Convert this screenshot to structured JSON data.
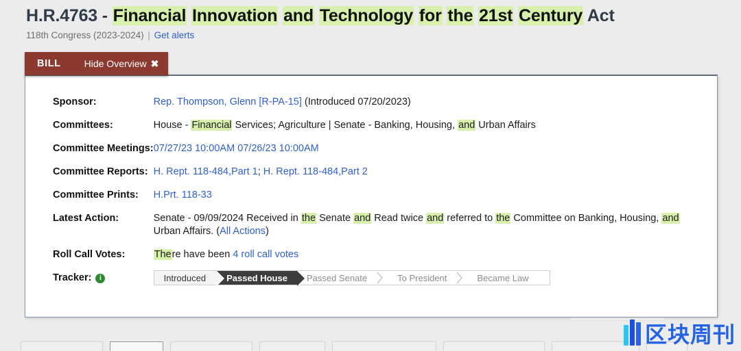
{
  "header": {
    "bill_number": "H.R.4763 - ",
    "title_tokens": [
      {
        "t": "Financial",
        "hl": true
      },
      {
        "t": " ",
        "hl": false
      },
      {
        "t": "Innovation",
        "hl": true
      },
      {
        "t": " ",
        "hl": false
      },
      {
        "t": "and",
        "hl": true
      },
      {
        "t": " ",
        "hl": false
      },
      {
        "t": "Technology",
        "hl": true
      },
      {
        "t": " ",
        "hl": false
      },
      {
        "t": "for",
        "hl": true
      },
      {
        "t": " ",
        "hl": false
      },
      {
        "t": "the",
        "hl": true
      },
      {
        "t": " ",
        "hl": false
      },
      {
        "t": "21st",
        "hl": true
      },
      {
        "t": " ",
        "hl": false
      },
      {
        "t": "Century",
        "hl": true
      },
      {
        "t": " Act",
        "hl": false
      }
    ],
    "title_plain": "H.R.4763 - Financial Innovation and Technology for the 21st Century Act",
    "congress": "118th Congress (2023-2024)",
    "separator": "|",
    "get_alerts_label": "Get alerts"
  },
  "card": {
    "tab_label": "BILL",
    "hide_overview_label": "Hide Overview",
    "close_glyph": "✖"
  },
  "rows": {
    "sponsor": {
      "label": "Sponsor:",
      "link": "Rep. Thompson, Glenn [R-PA-15]",
      "suffix": " (Introduced 07/20/2023)"
    },
    "committees": {
      "label": "Committees:",
      "pre": "House - ",
      "hl1": "Financial",
      "mid": " Services; Agriculture | Senate - Banking, Housing, ",
      "hl2": "and",
      "post": " Urban Affairs"
    },
    "committee_meetings": {
      "label": "Committee Meetings:",
      "links": [
        "07/27/23 10:00AM",
        "07/26/23 10:00AM"
      ]
    },
    "committee_reports": {
      "label": "Committee Reports:",
      "link1": "H. Rept. 118-484,Part 1",
      "sep": "; ",
      "link2": "H. Rept. 118-484,Part 2"
    },
    "committee_prints": {
      "label": "Committee Prints:",
      "link": "H.Prt. 118-33"
    },
    "latest_action": {
      "label": "Latest Action:",
      "p1": "Senate - 09/09/2024 Received in ",
      "h1": "the",
      "p2": " Senate ",
      "h2": "and",
      "p3": " Read twice ",
      "h3": "and",
      "p4": " referred to ",
      "h4": "the",
      "p5": " Committee on Banking, Housing, ",
      "h5": "and",
      "p6": " Urban Affairs.  (",
      "all_actions_label": "All Actions",
      "p7": ")"
    },
    "roll_call_votes": {
      "label": "Roll Call Votes:",
      "h1": "The",
      "p1": "re have been ",
      "link": "4 roll call votes"
    },
    "tracker": {
      "label": "Tracker:",
      "info_glyph": "i",
      "steps": [
        {
          "label": "Introduced",
          "state": "done"
        },
        {
          "label": "Passed House",
          "state": "current"
        },
        {
          "label": "Passed Senate",
          "state": "pending"
        },
        {
          "label": "To President",
          "state": "pending"
        },
        {
          "label": "Became Law",
          "state": "pending"
        }
      ]
    }
  },
  "watermark": {
    "text": "区块周刊"
  },
  "colors": {
    "page_bg": "#ececec",
    "highlight": "#d7f0ab",
    "tab_maroon": "#8c3a30",
    "link_blue": "#2f5fd0",
    "tracker_current": "#3d3d3d",
    "info_green": "#2e8b32",
    "watermark_blue": "#2563e6"
  }
}
